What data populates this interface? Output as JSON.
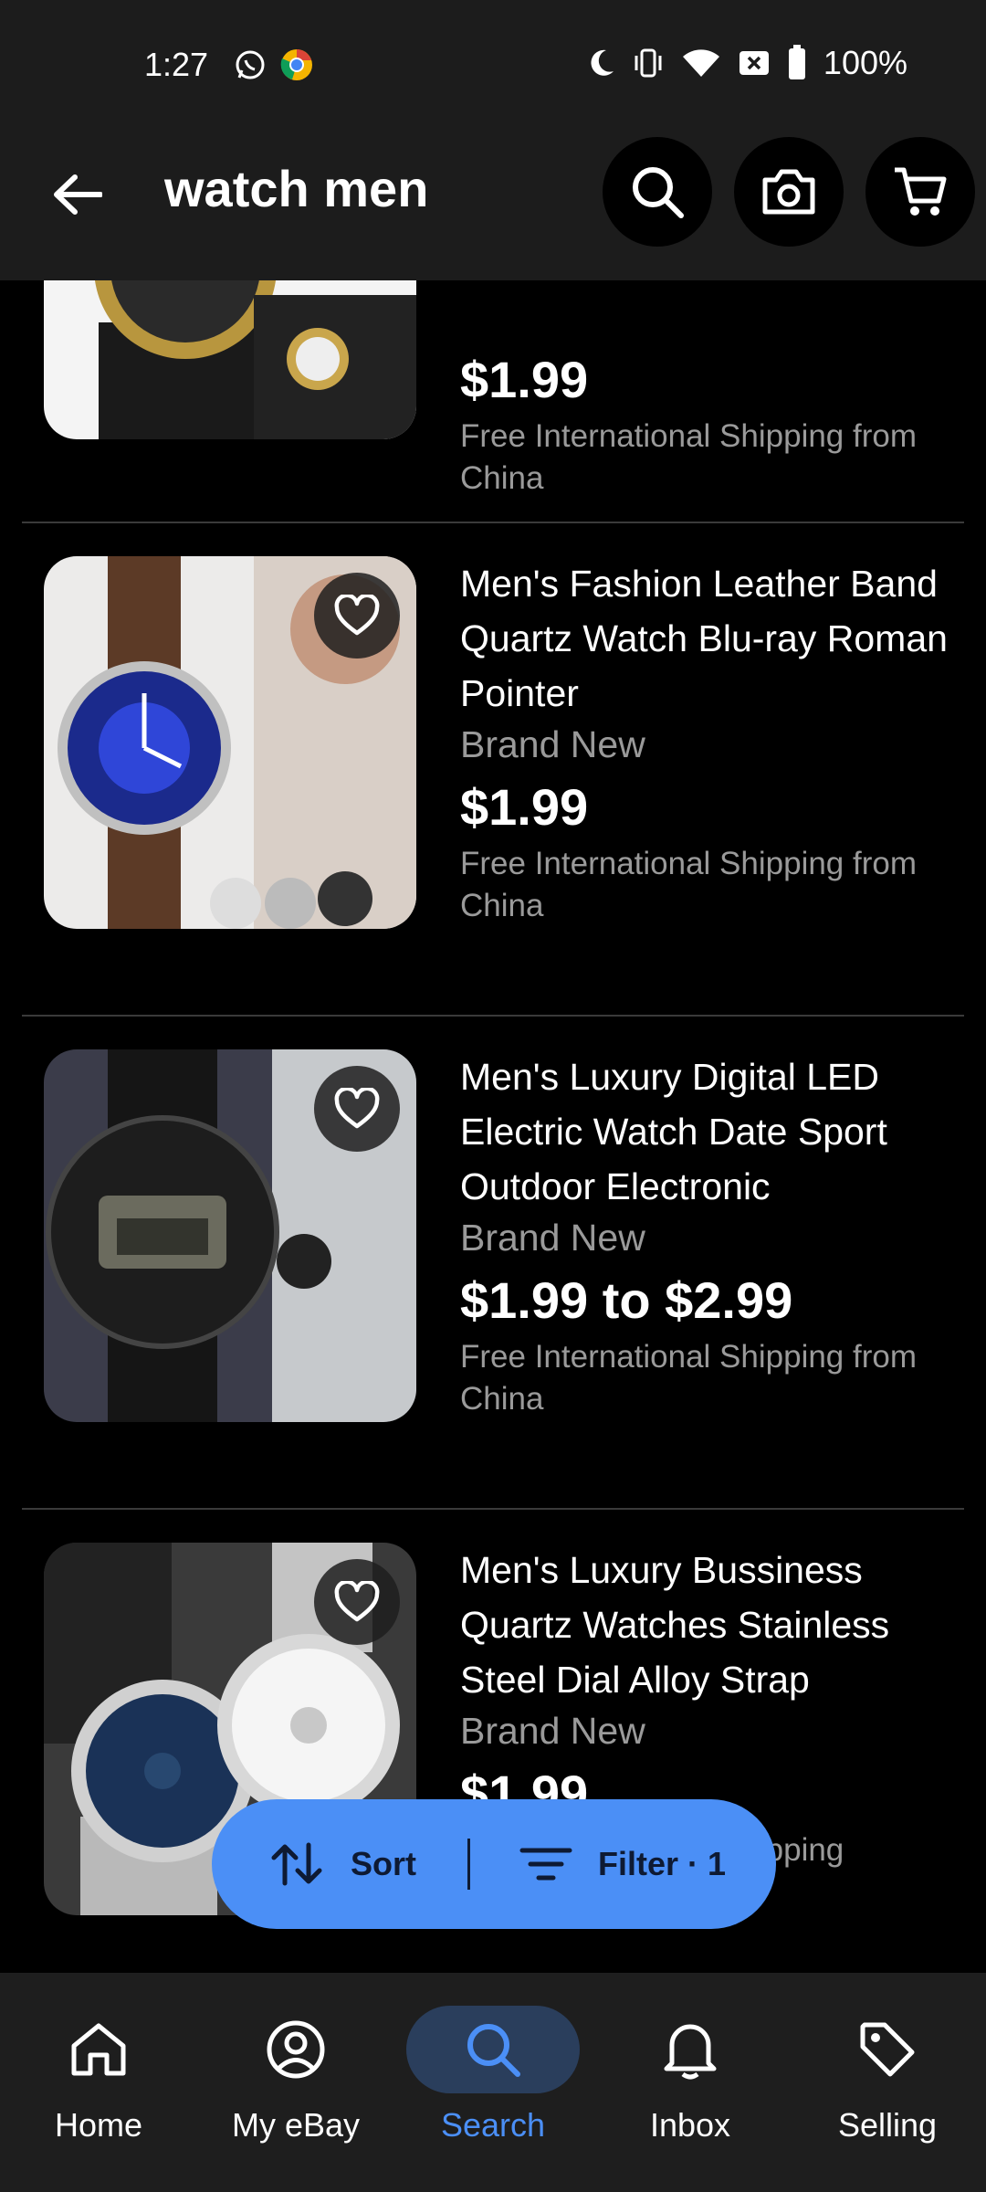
{
  "status_bar": {
    "time": "1:27",
    "battery": "100%",
    "icons": [
      "whatsapp-icon",
      "chrome-icon",
      "moon-icon",
      "vibrate-icon",
      "wifi-icon",
      "no-sim-icon",
      "battery-icon"
    ]
  },
  "header": {
    "title": "watch men",
    "icons": [
      "back-arrow-icon",
      "search-icon",
      "camera-icon",
      "cart-icon"
    ]
  },
  "items": [
    {
      "title": "",
      "condition": "",
      "price": "$1.99",
      "shipping": "Free International Shipping from China"
    },
    {
      "title": "Men's Fashion Leather Band Quartz Watch Blu-ray Roman Pointer",
      "condition": "Brand New",
      "price": "$1.99",
      "shipping": "Free International Shipping from China"
    },
    {
      "title": "Men's Luxury Digital LED Electric Watch Date Sport Outdoor Electronic",
      "condition": "Brand New",
      "price": "$1.99 to $2.99",
      "shipping": "Free International Shipping from China"
    },
    {
      "title": "Men's Luxury Bussiness Quartz Watches Stainless Steel Dial Alloy Strap",
      "condition": "Brand New",
      "price": "$1.99",
      "shipping": "Free International Shipping"
    }
  ],
  "sort_filter": {
    "sort_label": "Sort",
    "filter_label": "Filter · 1"
  },
  "bottom_nav": [
    {
      "label": "Home",
      "icon": "home-icon"
    },
    {
      "label": "My eBay",
      "icon": "user-icon"
    },
    {
      "label": "Search",
      "icon": "search-icon",
      "active": true
    },
    {
      "label": "Inbox",
      "icon": "bell-icon"
    },
    {
      "label": "Selling",
      "icon": "tag-icon"
    }
  ],
  "colors": {
    "accent": "#4b8ff6",
    "background": "#000000",
    "bar": "#1c1c1c",
    "secondary_text": "#9a9a9a"
  }
}
